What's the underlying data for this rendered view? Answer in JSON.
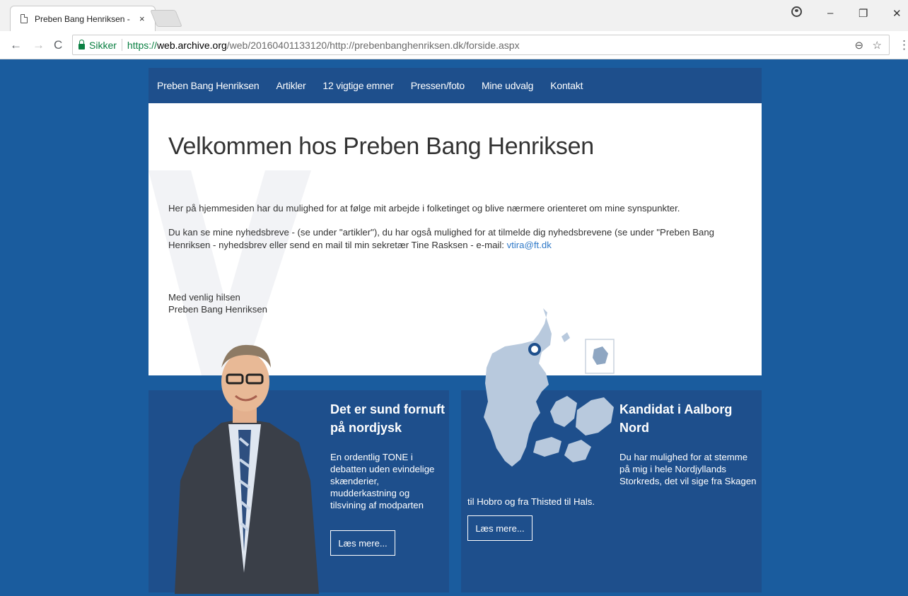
{
  "browser": {
    "tab_title": "Preben Bang Henriksen -",
    "tab_close": "×",
    "window_controls": {
      "minimize": "–",
      "restore": "❐",
      "close": "✕"
    },
    "nav": {
      "back": "←",
      "forward": "→",
      "reload": "C"
    },
    "secure_label": "Sikker",
    "url_scheme": "https://",
    "url_host": "web.archive.org",
    "url_rest": "/web/20160401133120/http://prebenbanghenriksen.dk/forside.aspx",
    "omni_icons": {
      "zoom": "⊖",
      "star": "☆",
      "menu": "⋮"
    }
  },
  "nav": {
    "items": [
      "Preben Bang Henriksen",
      "Artikler",
      "12 vigtige emner",
      "Pressen/foto",
      "Mine udvalg",
      "Kontakt"
    ]
  },
  "welcome": {
    "title": "Velkommen hos Preben Bang Henriksen",
    "para1": "Her på hjemmesiden har du mulighed for at følge mit arbejde i folketinget og blive nærmere orienteret om mine synspunkter.",
    "para2_text": "Du kan se mine nyhedsbreve - (se under \"artikler\"), du har også mulighed for at tilmelde dig nyhedsbrevene (se under \"Preben Bang Henriksen - nyhedsbrev eller send en mail til min sekretær Tine Rasksen - e-mail: ",
    "email": "vtira@ft.dk",
    "greeting_line1": "Med venlig hilsen",
    "greeting_line2": "Preben Bang Henriksen"
  },
  "card_left": {
    "title_line1": "Det er sund fornuft",
    "title_line2": "på nordjysk",
    "text": [
      "En ordentlig TONE i",
      "debatten uden evindelige",
      "skænderier,",
      "mudderkastning og",
      "tilsvining af modparten"
    ],
    "button": "Læs mere..."
  },
  "card_right": {
    "title_line1": "Kandidat i Aalborg",
    "title_line2": "Nord",
    "text": [
      "Du har mulighed for at stemme",
      "på mig i hele Nordjyllands",
      "Storkreds, det vil sige fra Skagen"
    ],
    "text_tail": "til Hobro og fra Thisted til Hals.",
    "button": "Læs mere..."
  },
  "colors": {
    "page_background": "#1a5c9e",
    "nav_background": "#1e4f8c",
    "link": "#2f79c8",
    "secure_green": "#0b8043"
  }
}
